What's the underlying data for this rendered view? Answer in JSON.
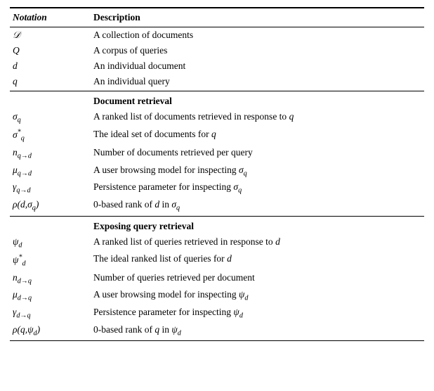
{
  "table": {
    "headers": {
      "notation": "Notation",
      "description": "Description"
    },
    "sections": [
      {
        "id": "basic",
        "rows": [
          {
            "notation_html": "<i>𝒟</i>",
            "description": "A collection of documents"
          },
          {
            "notation_html": "<i>Q</i>",
            "description": "A corpus of queries"
          },
          {
            "notation_html": "<i>d</i>",
            "description": "An individual document"
          },
          {
            "notation_html": "<i>q</i>",
            "description": "An individual query"
          }
        ]
      },
      {
        "id": "document-retrieval",
        "header": "Document retrieval",
        "rows": [
          {
            "notation_html": "<i>σ<sub>q</sub></i>",
            "description": "A ranked list of documents retrieved in response to <i>q</i>"
          },
          {
            "notation_html": "<i>σ<sup>*</sup><sub>q</sub></i>",
            "description": "The ideal set of documents for <i>q</i>"
          },
          {
            "notation_html": "<i>n<sub>q→d</sub></i>",
            "description": "Number of documents retrieved per query"
          },
          {
            "notation_html": "<i>μ<sub>q→d</sub></i>",
            "description": "A user browsing model for inspecting <i>σ<sub>q</sub></i>"
          },
          {
            "notation_html": "<i>γ<sub>q→d</sub></i>",
            "description": "Persistence parameter for inspecting <i>σ<sub>q</sub></i>"
          },
          {
            "notation_html": "<i>ρ(d,σ<sub>q</sub>)</i>",
            "description": "0-based rank of <i>d</i> in <i>σ<sub>q</sub></i>"
          }
        ]
      },
      {
        "id": "exposing-query",
        "header": "Exposing query retrieval",
        "rows": [
          {
            "notation_html": "<i>ψ<sub>d</sub></i>",
            "description": "A ranked list of queries retrieved in response to <i>d</i>"
          },
          {
            "notation_html": "<i>ψ<sup>*</sup><sub>d</sub></i>",
            "description": "The ideal ranked list of queries for <i>d</i>"
          },
          {
            "notation_html": "<i>n<sub>d→q</sub></i>",
            "description": "Number of queries retrieved per document"
          },
          {
            "notation_html": "<i>μ<sub>d→q</sub></i>",
            "description": "A user browsing model for inspecting <i>ψ<sub>d</sub></i>"
          },
          {
            "notation_html": "<i>γ<sub>d→q</sub></i>",
            "description": "Persistence parameter for inspecting <i>ψ<sub>d</sub></i>"
          },
          {
            "notation_html": "<i>ρ(q,ψ<sub>d</sub>)</i>",
            "description": "0-based rank of <i>q</i> in <i>ψ<sub>d</sub></i>"
          }
        ]
      }
    ]
  }
}
